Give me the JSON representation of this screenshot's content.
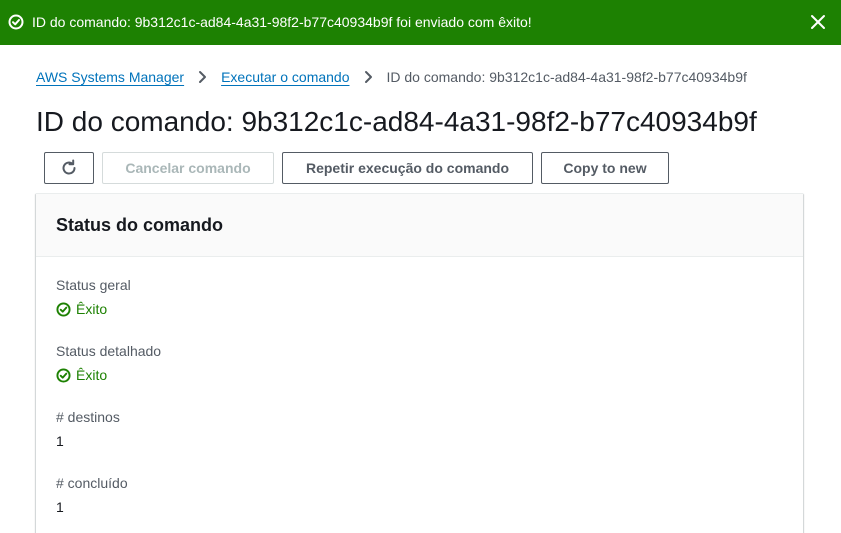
{
  "flash": {
    "message": "ID do comando: 9b312c1c-ad84-4a31-98f2-b77c40934b9f foi enviado com êxito!",
    "icon": "check-circle-icon",
    "close_icon": "close-icon",
    "background_color": "#1d8102"
  },
  "breadcrumb": {
    "items": [
      {
        "label": "AWS Systems Manager"
      },
      {
        "label": "Executar o comando"
      },
      {
        "label": "ID do comando: 9b312c1c-ad84-4a31-98f2-b77c40934b9f"
      }
    ],
    "separator_icon": "chevron-right-icon"
  },
  "page": {
    "title": "ID do comando: 9b312c1c-ad84-4a31-98f2-b77c40934b9f"
  },
  "toolbar": {
    "refresh_icon": "refresh-icon",
    "cancel_label": "Cancelar comando",
    "rerun_label": "Repetir execução do comando",
    "copy_label": "Copy to new"
  },
  "status_panel": {
    "title": "Status do comando",
    "fields": [
      {
        "label": "Status geral",
        "value": "Êxito",
        "status_color": "#1d8102"
      },
      {
        "label": "Status detalhado",
        "value": "Êxito",
        "status_color": "#1d8102"
      },
      {
        "label": "# destinos",
        "value": "1"
      },
      {
        "label": "# concluído",
        "value": "1"
      }
    ]
  }
}
